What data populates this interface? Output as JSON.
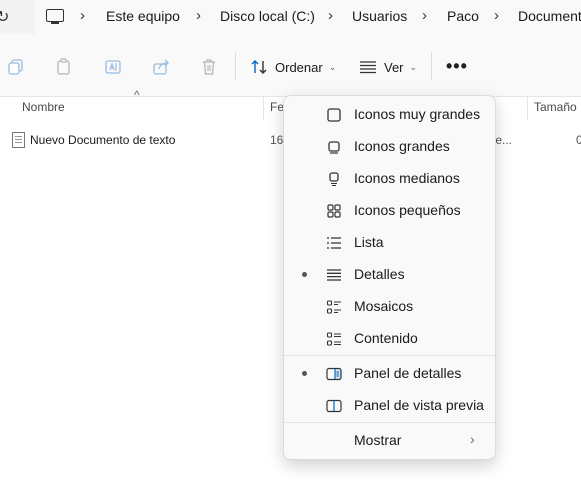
{
  "address": {
    "crumbs": [
      "Este equipo",
      "Disco local (C:)",
      "Usuarios",
      "Paco",
      "Document"
    ]
  },
  "toolbar": {
    "sort_label": "Ordenar",
    "view_label": "Ver",
    "more_label": "•••"
  },
  "columns": {
    "name": "Nombre",
    "date": "Fe",
    "size": "Tamaño"
  },
  "files": [
    {
      "name": "Nuevo Documento de texto",
      "date": "16",
      "type": "te...",
      "size": "0"
    }
  ],
  "view_menu": {
    "items": [
      {
        "label": "Iconos muy grandes",
        "icon": "extra-large-icons-icon",
        "selected": false
      },
      {
        "label": "Iconos grandes",
        "icon": "large-icons-icon",
        "selected": false
      },
      {
        "label": "Iconos medianos",
        "icon": "medium-icons-icon",
        "selected": false
      },
      {
        "label": "Iconos pequeños",
        "icon": "small-icons-icon",
        "selected": false
      },
      {
        "label": "Lista",
        "icon": "list-icon",
        "selected": false
      },
      {
        "label": "Detalles",
        "icon": "details-icon",
        "selected": true
      },
      {
        "label": "Mosaicos",
        "icon": "tiles-icon",
        "selected": false
      },
      {
        "label": "Contenido",
        "icon": "content-icon",
        "selected": false
      }
    ],
    "pane_items": [
      {
        "label": "Panel de detalles",
        "icon": "details-pane-icon",
        "selected": true
      },
      {
        "label": "Panel de vista previa",
        "icon": "preview-pane-icon",
        "selected": false
      }
    ],
    "show_label": "Mostrar"
  },
  "colors": {
    "background": "#ffffff",
    "toolbar": "#f9f9f9",
    "menu": "#f9f9f9",
    "accent_icon": "#0067c0"
  }
}
